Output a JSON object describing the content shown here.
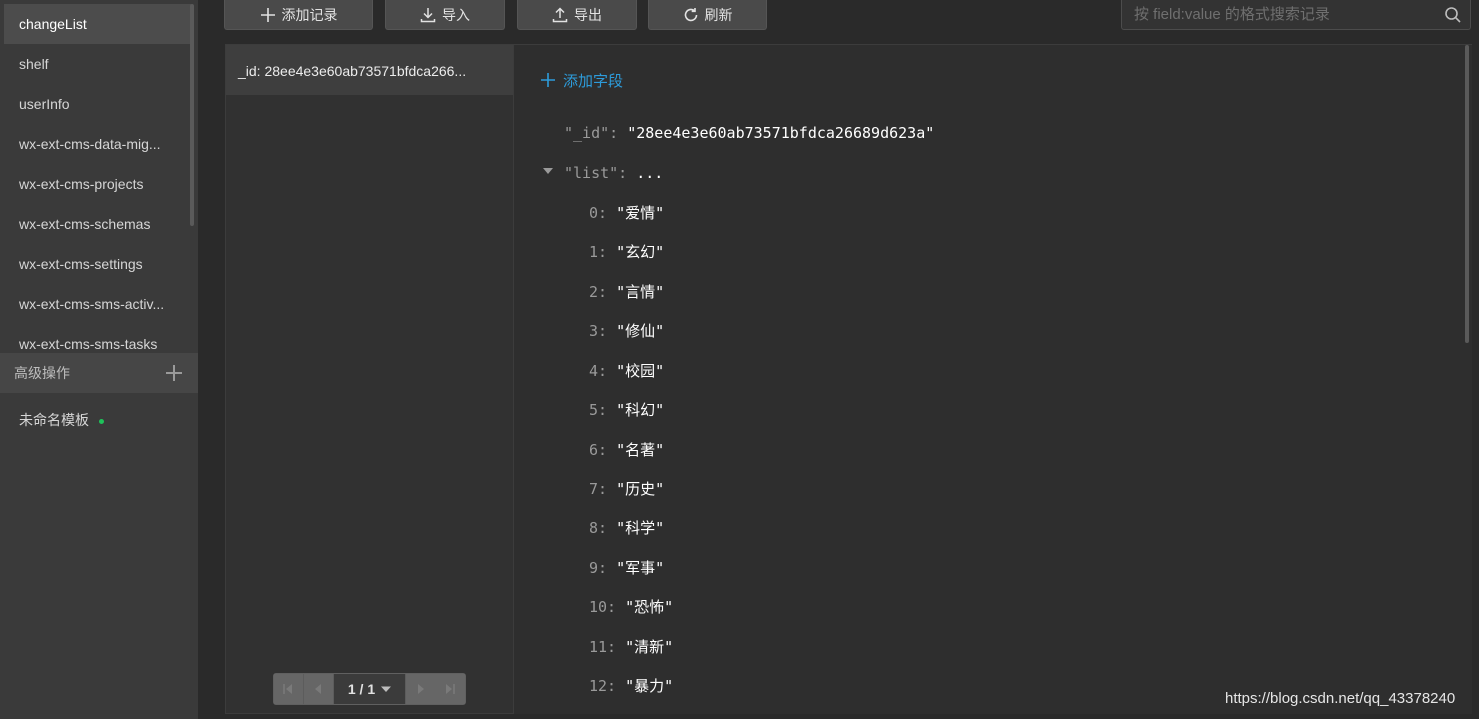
{
  "sidebar": {
    "collections": [
      {
        "label": "changeList",
        "active": true
      },
      {
        "label": "shelf",
        "active": false
      },
      {
        "label": "userInfo",
        "active": false
      },
      {
        "label": "wx-ext-cms-data-mig...",
        "active": false
      },
      {
        "label": "wx-ext-cms-projects",
        "active": false
      },
      {
        "label": "wx-ext-cms-schemas",
        "active": false
      },
      {
        "label": "wx-ext-cms-settings",
        "active": false
      },
      {
        "label": "wx-ext-cms-sms-activ...",
        "active": false
      },
      {
        "label": "wx-ext-cms-sms-tasks",
        "active": false
      }
    ],
    "advanced_label": "高级操作",
    "template_label": "未命名模板",
    "template_status_color": "#1ec25a"
  },
  "toolbar": {
    "add_record": "添加记录",
    "import": "导入",
    "export": "导出",
    "refresh": "刷新",
    "search_placeholder": "按 field:value 的格式搜索记录"
  },
  "records": {
    "items": [
      "_id: 28ee4e3e60ab73571bfdca266..."
    ],
    "pager": "1 / 1"
  },
  "detail": {
    "add_field": "添加字段",
    "id_key": "\"_id\":",
    "id_value": "\"28ee4e3e60ab73571bfdca26689d623a\"",
    "list_key": "\"list\":",
    "list_collapsed": "...",
    "list_items": [
      {
        "index": "0:",
        "value": "\"爱情\""
      },
      {
        "index": "1:",
        "value": "\"玄幻\""
      },
      {
        "index": "2:",
        "value": "\"言情\""
      },
      {
        "index": "3:",
        "value": "\"修仙\""
      },
      {
        "index": "4:",
        "value": "\"校园\""
      },
      {
        "index": "5:",
        "value": "\"科幻\""
      },
      {
        "index": "6:",
        "value": "\"名著\""
      },
      {
        "index": "7:",
        "value": "\"历史\""
      },
      {
        "index": "8:",
        "value": "\"科学\""
      },
      {
        "index": "9:",
        "value": "\"军事\""
      },
      {
        "index": "10:",
        "value": "\"恐怖\""
      },
      {
        "index": "11:",
        "value": "\"清新\""
      },
      {
        "index": "12:",
        "value": "\"暴力\""
      }
    ]
  },
  "watermark": "https://blog.csdn.net/qq_43378240",
  "colors": {
    "accent": "#2d9cdb",
    "sidebar_bg": "#3a3a3a",
    "panel_bg": "#2e2e2e"
  }
}
